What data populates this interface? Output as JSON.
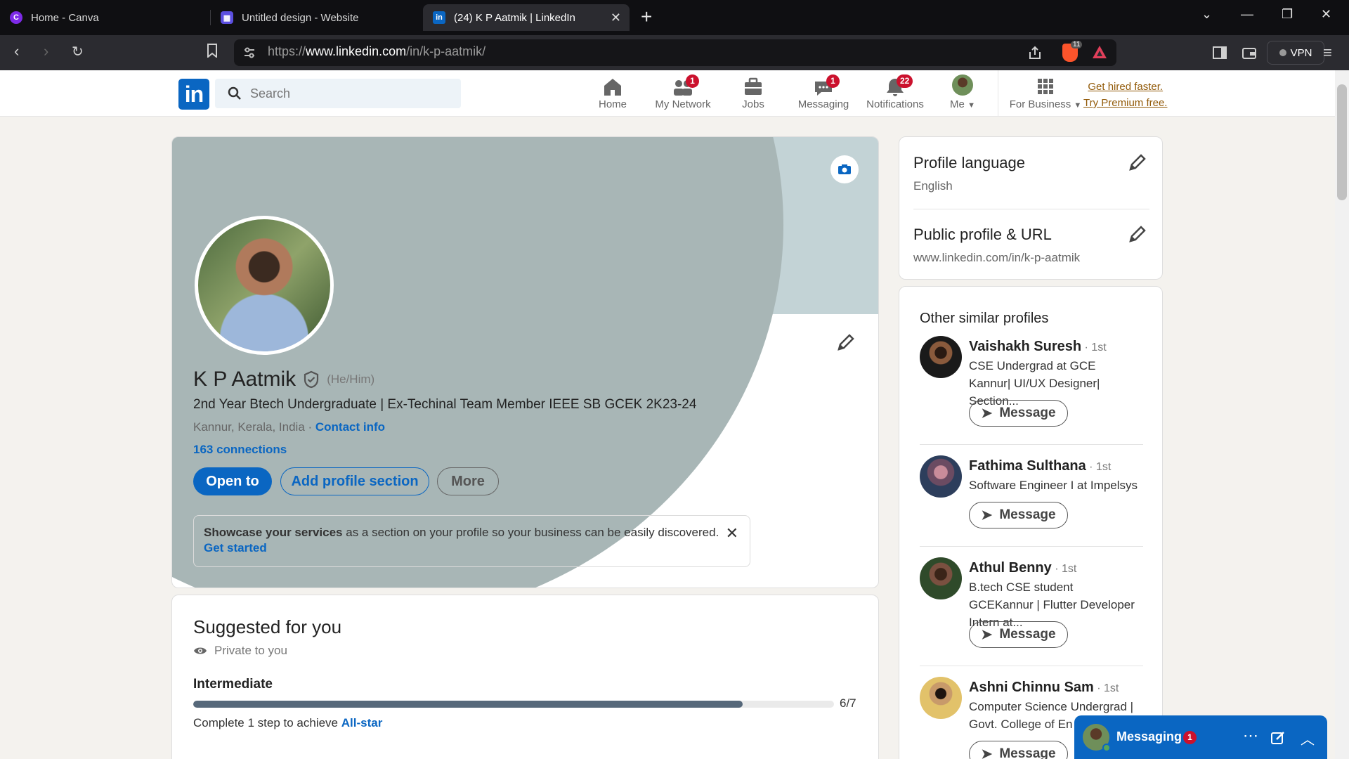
{
  "browser": {
    "tabs": [
      {
        "title": "Home - Canva"
      },
      {
        "title": "Untitled design - Website"
      },
      {
        "title": "(24) K P Aatmik | LinkedIn"
      }
    ],
    "url_prefix": "https://",
    "url_host": "www.linkedin.com",
    "url_path": "/in/k-p-aatmik/",
    "brave_badge": "11",
    "vpn_label": "VPN"
  },
  "header": {
    "logo": "in",
    "search_placeholder": "Search",
    "nav": [
      {
        "label": "Home",
        "icon": "home-icon",
        "badge": ""
      },
      {
        "label": "My Network",
        "icon": "network-icon",
        "badge": "1"
      },
      {
        "label": "Jobs",
        "icon": "briefcase-icon",
        "badge": ""
      },
      {
        "label": "Messaging",
        "icon": "messaging-icon",
        "badge": "1"
      },
      {
        "label": "Notifications",
        "icon": "bell-icon",
        "badge": "22"
      },
      {
        "label": "Me",
        "icon": "avatar",
        "badge": ""
      },
      {
        "label": "For Business",
        "icon": "grid-icon",
        "badge": ""
      }
    ],
    "premium_line1": "Get hired faster.",
    "premium_line2": "Try Premium free."
  },
  "profile": {
    "name": "K P Aatmik",
    "pronouns": "(He/Him)",
    "headline": "2nd Year Btech Undergraduate | Ex-Techinal Team Member IEEE SB GCEK 2K23-24",
    "location": "Kannur, Kerala, India",
    "location_sep": " · ",
    "contact_info": "Contact info",
    "connections": "163 connections",
    "buttons": {
      "open_to": "Open to",
      "add_section": "Add profile section",
      "more": "More"
    },
    "showcase_bold": "Showcase your services",
    "showcase_text": " as a section on your profile so your business can be easily discovered.",
    "showcase_link": "Get started"
  },
  "suggested": {
    "title": "Suggested for you",
    "privacy": "Private to you",
    "level": "Intermediate",
    "progress": "6/7",
    "progress_fraction": 0.857,
    "step_text": "Complete 1 step to achieve ",
    "step_link": "All-star"
  },
  "sidebar": {
    "profile_language_title": "Profile language",
    "profile_language_value": "English",
    "public_profile_title": "Public profile & URL",
    "public_profile_value": "www.linkedin.com/in/k-p-aatmik",
    "similar_title": "Other similar profiles",
    "message_label": "Message",
    "people": [
      {
        "name": "Vaishakh Suresh",
        "degree": " · 1st",
        "sub": "CSE Undergrad at GCE Kannur| UI/UX Designer| Section..."
      },
      {
        "name": "Fathima Sulthana",
        "degree": " · 1st",
        "sub": "Software Engineer I at Impelsys"
      },
      {
        "name": "Athul Benny",
        "degree": " · 1st",
        "sub": "B.tech CSE student GCEKannur | Flutter Developer Intern at..."
      },
      {
        "name": "Ashni Chinnu Sam",
        "degree": " · 1st",
        "sub": "Computer Science Undergrad | Govt. College of En"
      }
    ]
  },
  "messaging": {
    "label": "Messaging",
    "badge": "1"
  },
  "colors": {
    "accent": "#0a66c2",
    "badge": "#cb112d",
    "premium": "#915907"
  }
}
